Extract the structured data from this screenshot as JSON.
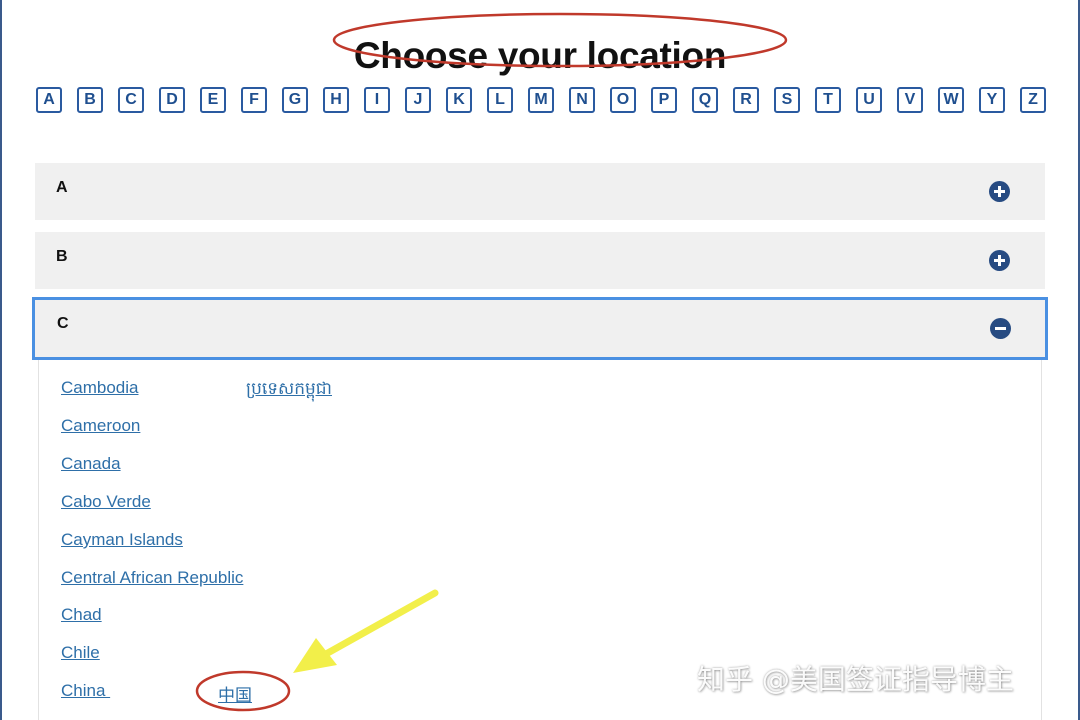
{
  "page": {
    "title": "Choose your location"
  },
  "letter_nav": {
    "letters": [
      "A",
      "B",
      "C",
      "D",
      "E",
      "F",
      "G",
      "H",
      "I",
      "J",
      "K",
      "L",
      "M",
      "N",
      "O",
      "P",
      "Q",
      "R",
      "S",
      "T",
      "U",
      "V",
      "W",
      "Y",
      "Z"
    ]
  },
  "sections": [
    {
      "label": "A",
      "state": "collapsed",
      "icon": "plus-circle-icon"
    },
    {
      "label": "B",
      "state": "collapsed",
      "icon": "plus-circle-icon"
    },
    {
      "label": "C",
      "state": "expanded",
      "icon": "minus-circle-icon"
    }
  ],
  "countries_c": [
    {
      "name": "Cambodia",
      "native": "ប្រទេសកម្ពុជា"
    },
    {
      "name": "Cameroon",
      "native": ""
    },
    {
      "name": "Canada",
      "native": ""
    },
    {
      "name": "Cabo Verde",
      "native": ""
    },
    {
      "name": "Cayman Islands",
      "native": ""
    },
    {
      "name": "Central African Republic",
      "native": ""
    },
    {
      "name": "Chad",
      "native": ""
    },
    {
      "name": "Chile",
      "native": ""
    },
    {
      "name": "China ",
      "native": "中国"
    }
  ],
  "watermark": {
    "text": "知乎 @美国签证指导博主"
  },
  "colors": {
    "link": "#2e6fa8",
    "letter_border": "#2a5aa0",
    "section_bg": "#f0f0f0",
    "open_section_border": "#4a90e2",
    "toggle_icon": "#274b82",
    "annotation_red": "#c0392b",
    "annotation_yellow": "#f2ef4a"
  }
}
